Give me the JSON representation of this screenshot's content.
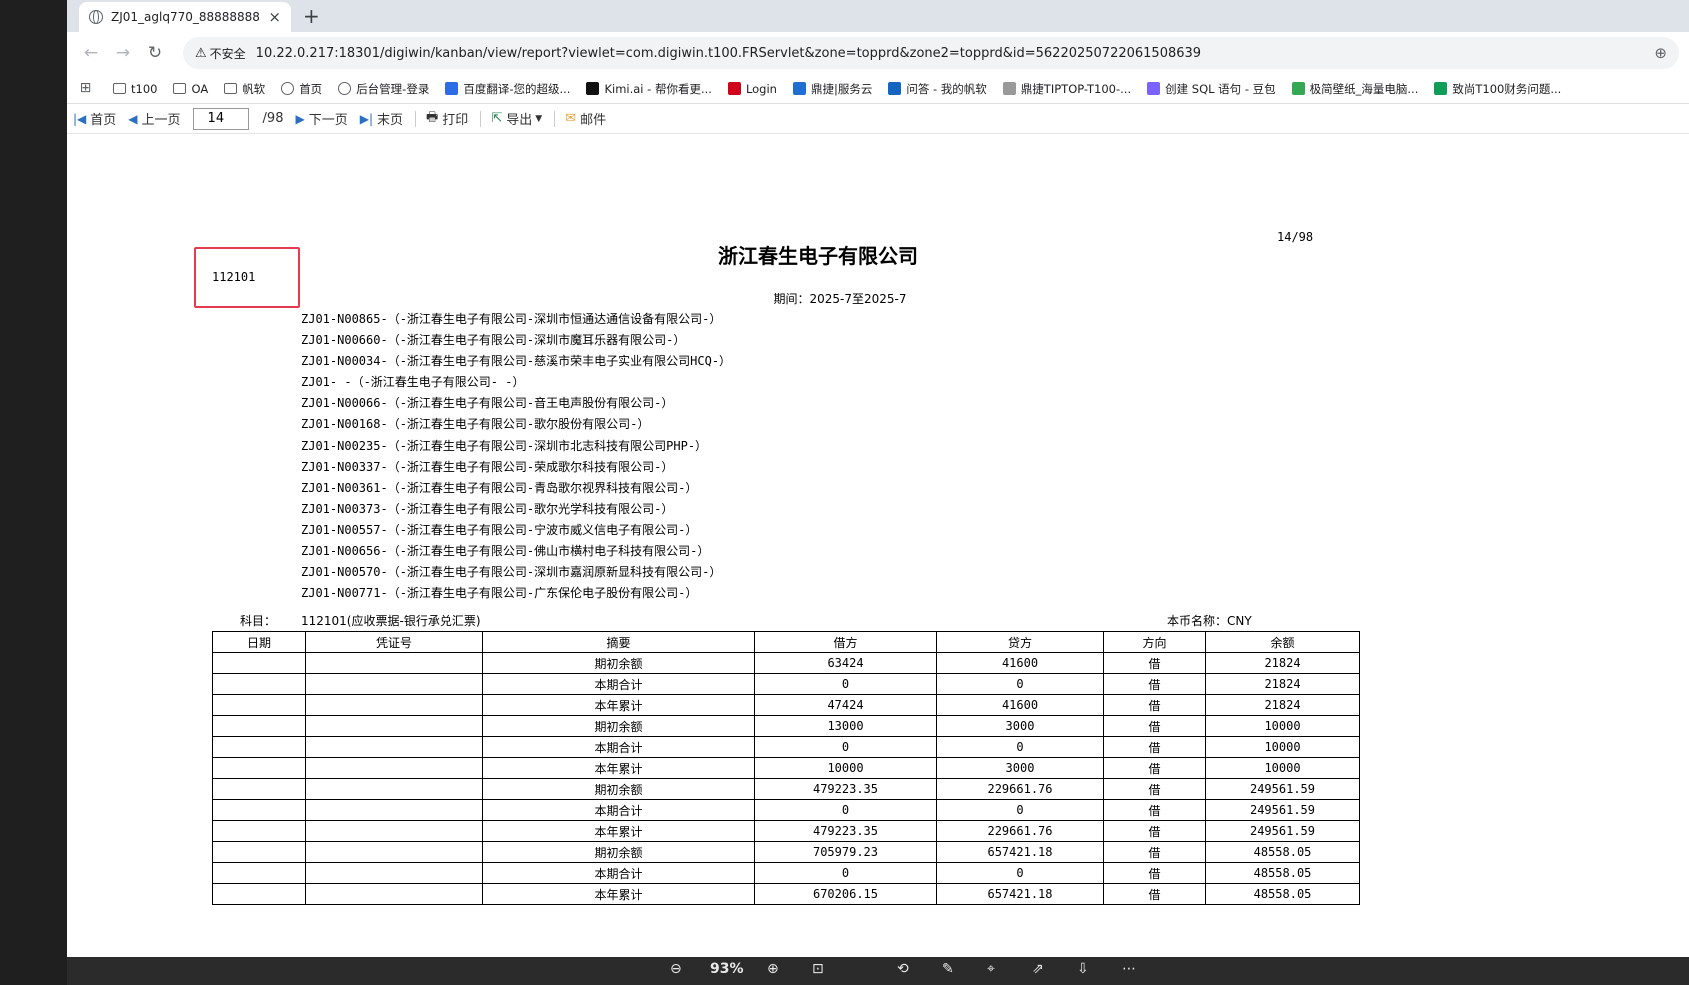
{
  "tab": {
    "title": "ZJ01_aglq770_88888888",
    "close": "×",
    "new": "+"
  },
  "address": {
    "back": "←",
    "forward": "→",
    "reload": "↻",
    "insecure_label": "不安全",
    "url": "10.22.0.217:18301/digiwin/kanban/view/report?viewlet=com.digiwin.t100.FRServlet&zone=topprd&zone2=topprd&id=56220250722061508639"
  },
  "bookmarks": [
    {
      "icon": "apps-icon",
      "label": ""
    },
    {
      "icon": "folder-icon",
      "label": "t100"
    },
    {
      "icon": "folder-icon",
      "label": "OA"
    },
    {
      "icon": "folder-icon",
      "label": "帆软"
    },
    {
      "icon": "globe-icon",
      "label": "首页"
    },
    {
      "icon": "globe-icon",
      "label": "后台管理-登录"
    },
    {
      "icon": "translate-icon",
      "label": "百度翻译-您的超级..."
    },
    {
      "icon": "kimi-icon",
      "label": "Kimi.ai - 帮你看更..."
    },
    {
      "icon": "login-icon",
      "label": "Login"
    },
    {
      "icon": "dingjie-icon",
      "label": "鼎捷|服务云"
    },
    {
      "icon": "fanruan-icon",
      "label": "问答 - 我的帆软"
    },
    {
      "icon": "tiptop-icon",
      "label": "鼎捷TIPTOP-T100-..."
    },
    {
      "icon": "doubao-icon",
      "label": "创建 SQL 语句 - 豆包"
    },
    {
      "icon": "wallpaper-icon",
      "label": "极简壁纸_海量电脑..."
    },
    {
      "icon": "sheet-icon",
      "label": "致尚T100财务问题..."
    }
  ],
  "toolbar": {
    "first": "首页",
    "prev": "上一页",
    "page_value": "14",
    "page_total": "/98",
    "next": "下一页",
    "last": "末页",
    "print": "打印",
    "export": "导出",
    "mail": "邮件"
  },
  "report": {
    "page_num": "14/98",
    "company": "浙江春生电子有限公司",
    "code": "112101",
    "period": "期间：2025-7至2025-7",
    "vendors": [
      "ZJ01-N00865-（-浙江春生电子有限公司-深圳市恒通达通信设备有限公司-）",
      "ZJ01-N00660-（-浙江春生电子有限公司-深圳市魔耳乐器有限公司-）",
      "ZJ01-N00034-（-浙江春生电子有限公司-慈溪市荣丰电子实业有限公司HCQ-）",
      "ZJ01- -（-浙江春生电子有限公司- -）",
      "ZJ01-N00066-（-浙江春生电子有限公司-音王电声股份有限公司-）",
      "ZJ01-N00168-（-浙江春生电子有限公司-歌尔股份有限公司-）",
      "ZJ01-N00235-（-浙江春生电子有限公司-深圳市北志科技有限公司PHP-）",
      "ZJ01-N00337-（-浙江春生电子有限公司-荣成歌尔科技有限公司-）",
      "ZJ01-N00361-（-浙江春生电子有限公司-青岛歌尔视界科技有限公司-）",
      "ZJ01-N00373-（-浙江春生电子有限公司-歌尔光学科技有限公司-）",
      "ZJ01-N00557-（-浙江春生电子有限公司-宁波市威义信电子有限公司-）",
      "ZJ01-N00656-（-浙江春生电子有限公司-佛山市横村电子科技有限公司-）",
      "ZJ01-N00570-（-浙江春生电子有限公司-深圳市嘉润原新显科技有限公司-）",
      "ZJ01-N00771-（-浙江春生电子有限公司-广东保伦电子股份有限公司-）"
    ],
    "subject_label": "科目：",
    "subject_value": "112101(应收票据-银行承兑汇票)",
    "currency": "本币名称：CNY",
    "columns": [
      "日期",
      "凭证号",
      "摘要",
      "借方",
      "贷方",
      "方向",
      "余额"
    ],
    "rows": [
      [
        "",
        "",
        "期初余额",
        "63424",
        "41600",
        "借",
        "21824"
      ],
      [
        "",
        "",
        "本期合计",
        "0",
        "0",
        "借",
        "21824"
      ],
      [
        "",
        "",
        "本年累计",
        "47424",
        "41600",
        "借",
        "21824"
      ],
      [
        "",
        "",
        "期初余额",
        "13000",
        "3000",
        "借",
        "10000"
      ],
      [
        "",
        "",
        "本期合计",
        "0",
        "0",
        "借",
        "10000"
      ],
      [
        "",
        "",
        "本年累计",
        "10000",
        "3000",
        "借",
        "10000"
      ],
      [
        "",
        "",
        "期初余额",
        "479223.35",
        "229661.76",
        "借",
        "249561.59"
      ],
      [
        "",
        "",
        "本期合计",
        "0",
        "0",
        "借",
        "249561.59"
      ],
      [
        "",
        "",
        "本年累计",
        "479223.35",
        "229661.76",
        "借",
        "249561.59"
      ],
      [
        "",
        "",
        "期初余额",
        "705979.23",
        "657421.18",
        "借",
        "48558.05"
      ],
      [
        "",
        "",
        "本期合计",
        "0",
        "0",
        "借",
        "48558.05"
      ],
      [
        "",
        "",
        "本年累计",
        "670206.15",
        "657421.18",
        "借",
        "48558.05"
      ]
    ]
  },
  "bottom": {
    "zoom": "93%"
  }
}
